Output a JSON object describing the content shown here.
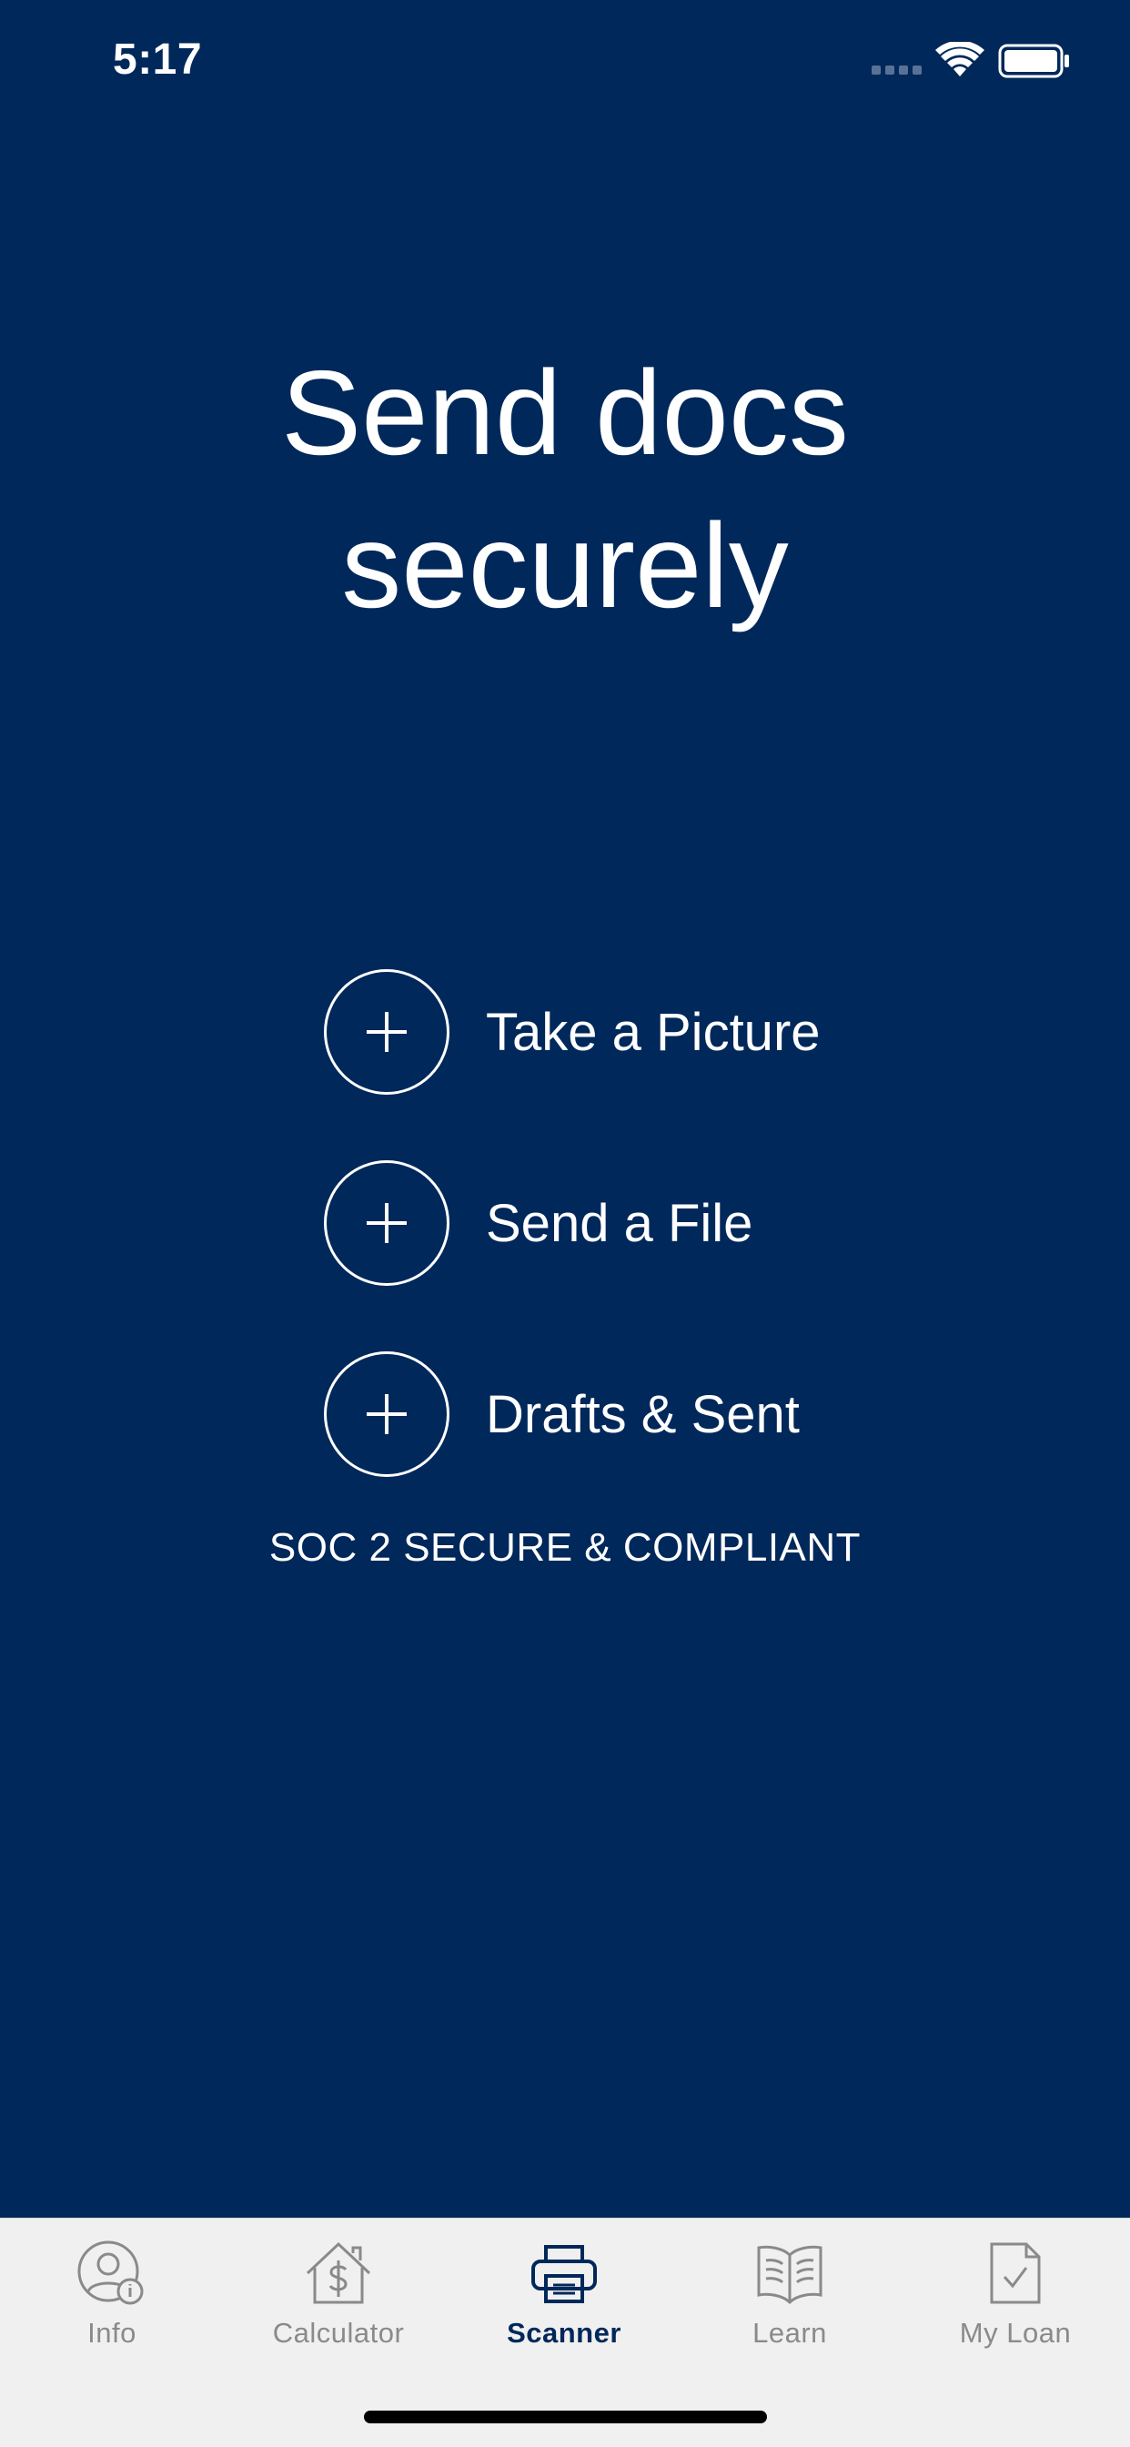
{
  "status_bar": {
    "time": "5:17",
    "icons": [
      "signal-dots-icon",
      "wifi-icon",
      "battery-icon"
    ]
  },
  "headline": {
    "line1": "Send docs",
    "line2": "securely"
  },
  "actions": [
    {
      "icon": "plus-icon",
      "label": "Take a Picture"
    },
    {
      "icon": "plus-icon",
      "label": "Send a File"
    },
    {
      "icon": "plus-icon",
      "label": "Drafts & Sent"
    }
  ],
  "compliance_text": "SOC 2 SECURE & COMPLIANT",
  "tab_bar": {
    "active_tab": "Scanner",
    "tabs": [
      {
        "icon": "user-info-icon",
        "label": "Info"
      },
      {
        "icon": "house-dollar-icon",
        "label": "Calculator"
      },
      {
        "icon": "printer-icon",
        "label": "Scanner"
      },
      {
        "icon": "open-book-icon",
        "label": "Learn"
      },
      {
        "icon": "document-check-icon",
        "label": "My Loan"
      }
    ]
  },
  "colors": {
    "background": "#00285a",
    "foreground": "#ffffff",
    "tab_bar_bg": "#f0f0f0",
    "tab_inactive": "#8a8a8a",
    "tab_active": "#00285a"
  }
}
